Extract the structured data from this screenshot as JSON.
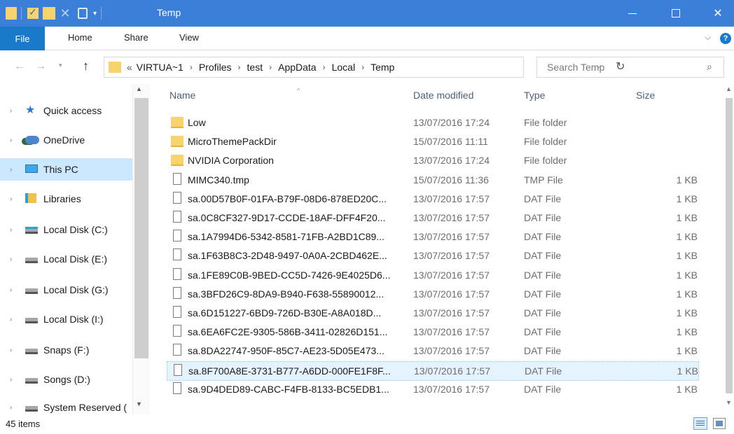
{
  "window": {
    "title": "Temp",
    "controls": {
      "minimize": "",
      "maximize": "",
      "close": "✕"
    }
  },
  "quick_access_toolbar": [
    "folder-icon",
    "properties-check-icon",
    "new-folder-icon",
    "delete-icon",
    "rename-icon",
    "customize-dropdown"
  ],
  "ribbon": {
    "tabs": [
      "File",
      "Home",
      "Share",
      "View"
    ],
    "active_tab": "File"
  },
  "address": {
    "lead": "«",
    "breadcrumbs": [
      "VIRTUA~1",
      "Profiles",
      "test",
      "AppData",
      "Local",
      "Temp"
    ],
    "search_placeholder": "Search Temp"
  },
  "navigation": {
    "items": [
      {
        "label": "Quick access",
        "icon": "star-icon",
        "selected": false
      },
      {
        "label": "OneDrive",
        "icon": "onedrive-icon",
        "selected": false
      },
      {
        "label": "This PC",
        "icon": "this-pc-icon",
        "selected": true
      },
      {
        "label": "Libraries",
        "icon": "libraries-icon",
        "selected": false
      },
      {
        "label": "Local Disk (C:)",
        "icon": "system-drive-icon",
        "selected": false
      },
      {
        "label": "Local Disk (E:)",
        "icon": "drive-icon",
        "selected": false
      },
      {
        "label": "Local Disk (G:)",
        "icon": "drive-icon",
        "selected": false
      },
      {
        "label": "Local Disk (I:)",
        "icon": "drive-icon",
        "selected": false
      },
      {
        "label": "Snaps (F:)",
        "icon": "drive-icon",
        "selected": false
      },
      {
        "label": "Songs (D:)",
        "icon": "drive-icon",
        "selected": false
      },
      {
        "label": "System Reserved (",
        "icon": "drive-icon",
        "selected": false
      }
    ]
  },
  "file_list": {
    "columns": [
      "Name",
      "Date modified",
      "Type",
      "Size"
    ],
    "sort_column": "Name",
    "rows": [
      {
        "name": "Low",
        "date": "13/07/2016 17:24",
        "type": "File folder",
        "size": "",
        "icon": "folder-icon"
      },
      {
        "name": "MicroThemePackDir",
        "date": "15/07/2016 11:11",
        "type": "File folder",
        "size": "",
        "icon": "folder-icon"
      },
      {
        "name": "NVIDIA Corporation",
        "date": "13/07/2016 17:24",
        "type": "File folder",
        "size": "",
        "icon": "folder-icon"
      },
      {
        "name": "MIMC340.tmp",
        "date": "15/07/2016 11:36",
        "type": "TMP File",
        "size": "1 KB",
        "icon": "file-icon"
      },
      {
        "name": "sa.00D57B0F-01FA-B79F-08D6-878ED20C...",
        "date": "13/07/2016 17:57",
        "type": "DAT File",
        "size": "1 KB",
        "icon": "file-icon"
      },
      {
        "name": "sa.0C8CF327-9D17-CCDE-18AF-DFF4F20...",
        "date": "13/07/2016 17:57",
        "type": "DAT File",
        "size": "1 KB",
        "icon": "file-icon"
      },
      {
        "name": "sa.1A7994D6-5342-8581-71FB-A2BD1C89...",
        "date": "13/07/2016 17:57",
        "type": "DAT File",
        "size": "1 KB",
        "icon": "file-icon"
      },
      {
        "name": "sa.1F63B8C3-2D48-9497-0A0A-2CBD462E...",
        "date": "13/07/2016 17:57",
        "type": "DAT File",
        "size": "1 KB",
        "icon": "file-icon"
      },
      {
        "name": "sa.1FE89C0B-9BED-CC5D-7426-9E4025D6...",
        "date": "13/07/2016 17:57",
        "type": "DAT File",
        "size": "1 KB",
        "icon": "file-icon"
      },
      {
        "name": "sa.3BFD26C9-8DA9-B940-F638-55890012...",
        "date": "13/07/2016 17:57",
        "type": "DAT File",
        "size": "1 KB",
        "icon": "file-icon"
      },
      {
        "name": "sa.6D151227-6BD9-726D-B30E-A8A018D...",
        "date": "13/07/2016 17:57",
        "type": "DAT File",
        "size": "1 KB",
        "icon": "file-icon"
      },
      {
        "name": "sa.6EA6FC2E-9305-586B-3411-02826D151...",
        "date": "13/07/2016 17:57",
        "type": "DAT File",
        "size": "1 KB",
        "icon": "file-icon"
      },
      {
        "name": "sa.8DA22747-950F-85C7-AE23-5D05E473...",
        "date": "13/07/2016 17:57",
        "type": "DAT File",
        "size": "1 KB",
        "icon": "file-icon"
      },
      {
        "name": "sa.8F700A8E-3731-B777-A6DD-000FE1F8F...",
        "date": "13/07/2016 17:57",
        "type": "DAT File",
        "size": "1 KB",
        "icon": "file-icon",
        "selected": true
      },
      {
        "name": "sa.9D4DED89-CABC-F4FB-8133-BC5EDB1...",
        "date": "13/07/2016 17:57",
        "type": "DAT File",
        "size": "1 KB",
        "icon": "file-icon"
      }
    ]
  },
  "status": {
    "item_count": "45 items",
    "view_buttons": [
      "details-view-icon",
      "large-icons-view-icon"
    ],
    "active_view": "details-view-icon"
  },
  "colors": {
    "titlebar": "#3b7fd8",
    "file_tab": "#1979ca",
    "selection": "#cce8ff",
    "row_selection": "#e5f3ff",
    "folder": "#f6d36c"
  }
}
